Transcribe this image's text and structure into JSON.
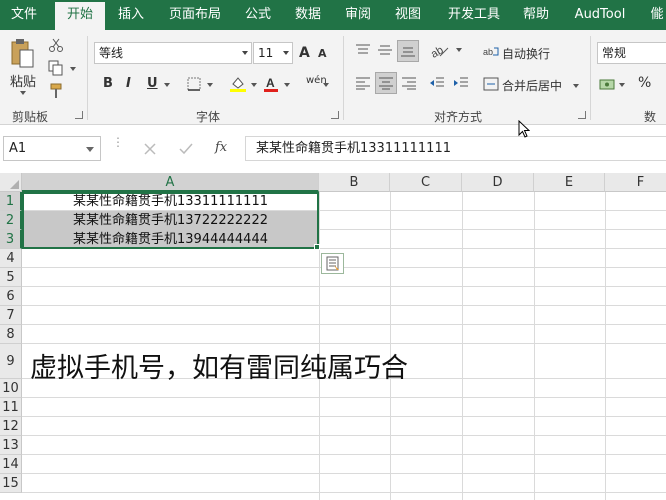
{
  "ribbon": {
    "tabs": [
      "文件",
      "开始",
      "插入",
      "页面布局",
      "公式",
      "数据",
      "审阅",
      "视图",
      "开发工具",
      "帮助",
      "AudTool",
      "㑷"
    ],
    "active_tab": "开始",
    "accent_color": "#217346",
    "clipboard": {
      "paste_label": "粘贴",
      "group_label": "剪贴板"
    },
    "font": {
      "name": "等线",
      "size": "11",
      "group_label": "字体",
      "bold": "B",
      "italic": "I",
      "underline": "U",
      "grow": "A",
      "shrink": "A",
      "phonetic": "wén"
    },
    "alignment": {
      "wrap_label": "自动换行",
      "merge_label": "合并后居中",
      "group_label": "对齐方式"
    },
    "number": {
      "format": "常规",
      "percent": "%",
      "group_label": "数字"
    }
  },
  "formula_bar": {
    "name_box": "A1",
    "fx": "fx",
    "content": "某某性命籍贯手机13311111111"
  },
  "grid": {
    "columns": [
      "A",
      "B",
      "C",
      "D",
      "E",
      "F"
    ],
    "rows": [
      "1",
      "2",
      "3",
      "4",
      "5",
      "6",
      "7",
      "8",
      "9",
      "10",
      "11",
      "12",
      "13",
      "14",
      "15"
    ],
    "cells": [
      "某某性命籍贯手机13311111111",
      "某某性命籍贯手机13722222222",
      "某某性命籍贯手机13944444444"
    ],
    "note": "虚拟手机号，如有雷同纯属巧合"
  }
}
